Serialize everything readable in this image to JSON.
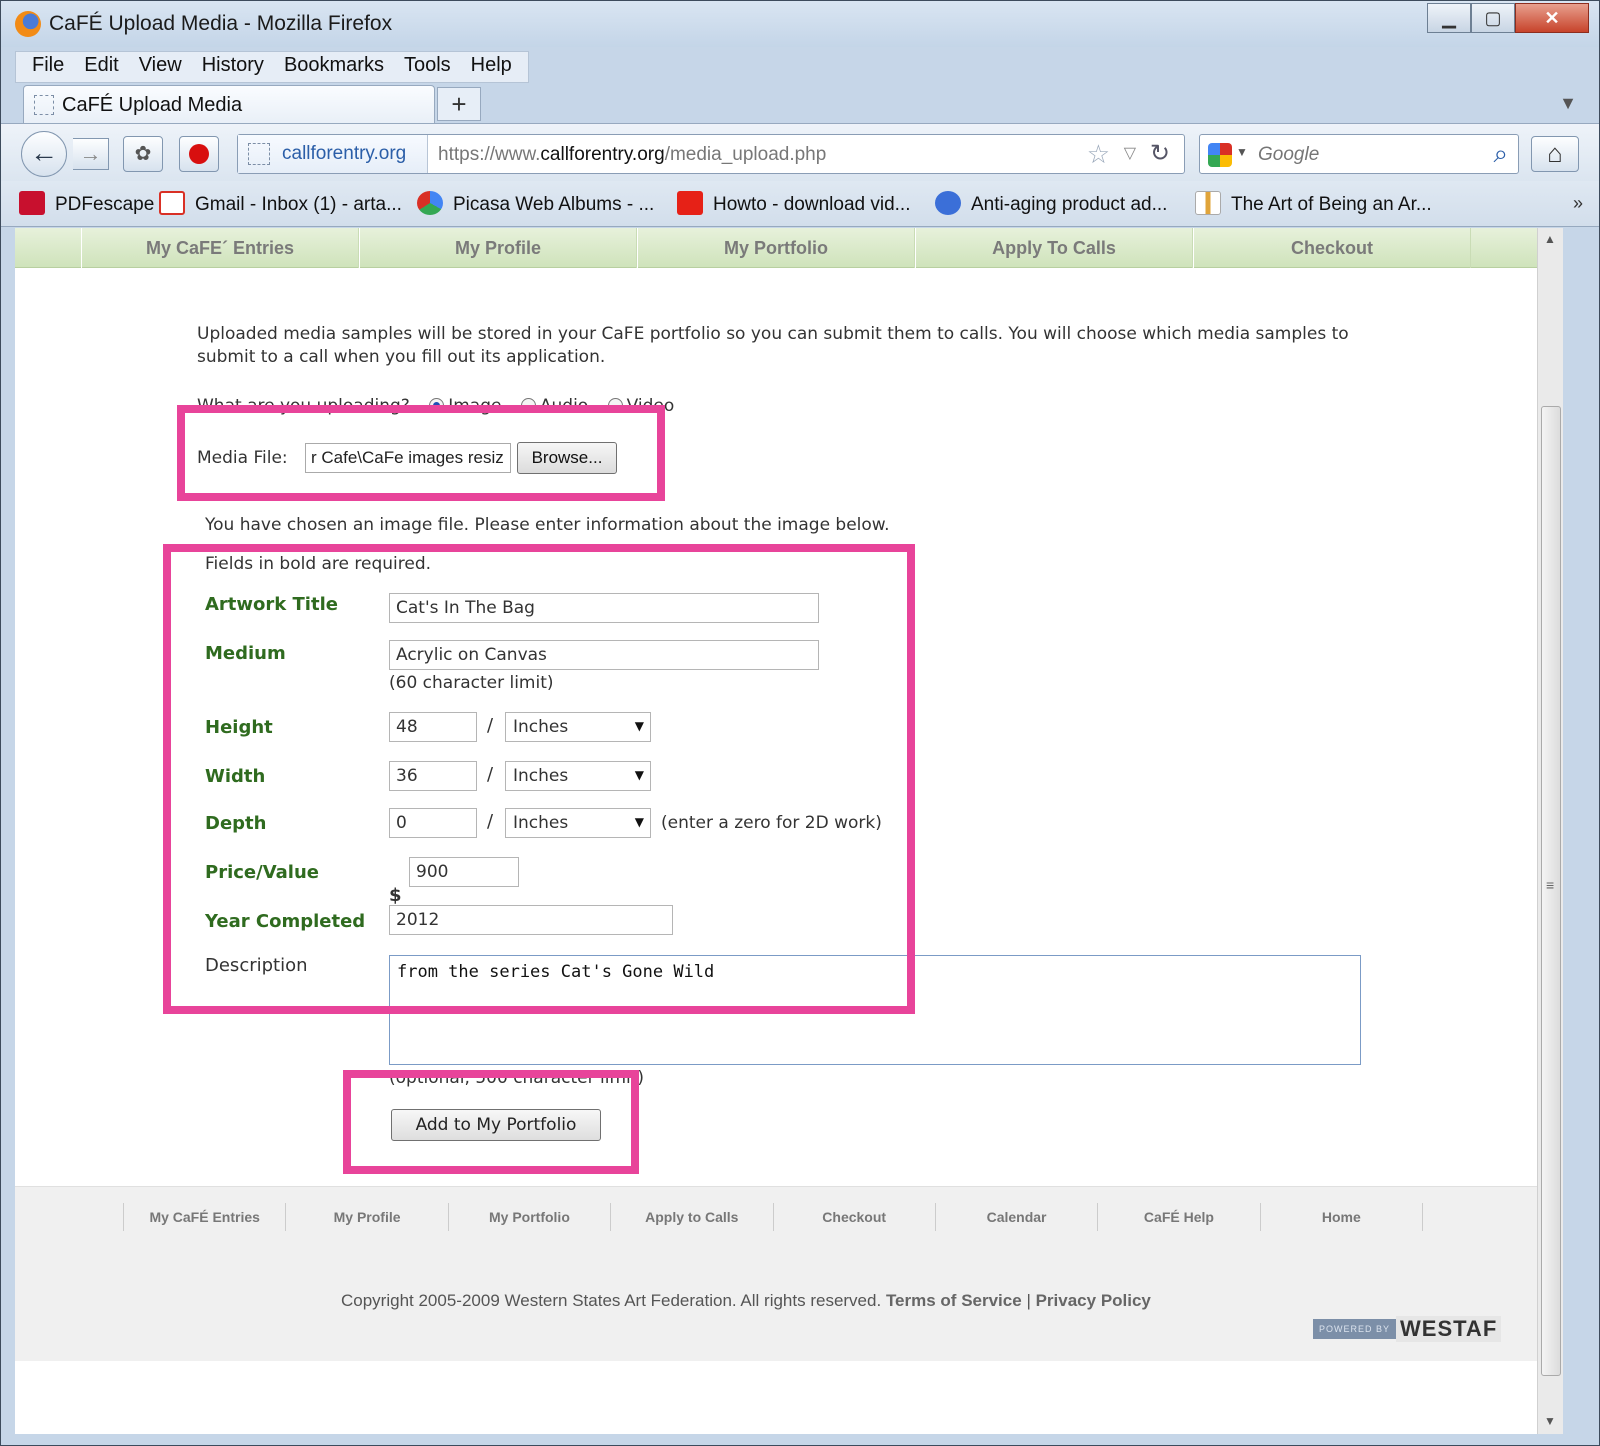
{
  "window": {
    "title": "CaFÉ Upload Media - Mozilla Firefox",
    "min": "▁",
    "max": "▢",
    "close": "✕"
  },
  "menu": [
    "File",
    "Edit",
    "View",
    "History",
    "Bookmarks",
    "Tools",
    "Help"
  ],
  "tab": {
    "label": "CaFÉ Upload Media",
    "new_tab": "+"
  },
  "nav": {
    "identity": "callforentry.org",
    "url_prefix": "https://www.",
    "url_domain": "callforentry.org",
    "url_path": "/media_upload.php",
    "search_placeholder": "Google"
  },
  "bookmarks": [
    {
      "label": "PDFescape",
      "icon": "pdf-icon",
      "color": "#c8102e"
    },
    {
      "label": "Gmail - Inbox (1) - arta...",
      "icon": "gmail-icon",
      "color": "#d93025"
    },
    {
      "label": "Picasa Web Albums - ...",
      "icon": "picasa-icon",
      "color": "#4285f4"
    },
    {
      "label": "Howto - download vid...",
      "icon": "youtube-icon",
      "color": "#e62117"
    },
    {
      "label": "Anti-aging product ad...",
      "icon": "globe-icon",
      "color": "#3b6fd8"
    },
    {
      "label": "The Art of Being an Ar...",
      "icon": "bookmark-page-icon",
      "color": "#e0a43a"
    }
  ],
  "bookmarks_more": "»",
  "site_nav": [
    "My CaFE´ Entries",
    "My Profile",
    "My Portfolio",
    "Apply To Calls",
    "Checkout"
  ],
  "page": {
    "intro": "Uploaded media samples will be stored in your CaFE portfolio so you can submit them to calls. You will choose which media samples to submit to a call when you fill out its application.",
    "upload_question": "What are you uploading?",
    "upload_types": [
      "Image",
      "Audio",
      "Video"
    ],
    "upload_selected": "Image",
    "media_file_label": "Media File:",
    "media_file_value": "r Cafe\\CaFe images resiz",
    "browse_label": "Browse...",
    "chosen_text": "You have chosen an image file. Please enter information about the image below.",
    "required_text": "Fields in bold are required."
  },
  "form": {
    "artwork_title_label": "Artwork Title",
    "artwork_title_value": "Cat's In The Bag",
    "medium_label": "Medium",
    "medium_value": "Acrylic on Canvas",
    "medium_note": "(60 character limit)",
    "height_label": "Height",
    "height_value": "48",
    "height_unit": "Inches",
    "width_label": "Width",
    "width_value": "36",
    "width_unit": "Inches",
    "depth_label": "Depth",
    "depth_value": "0",
    "depth_unit": "Inches",
    "depth_note": "(enter a zero for 2D work)",
    "slash": "/",
    "price_label": "Price/Value",
    "currency": "$",
    "price_value": "900",
    "year_label": "Year Completed",
    "year_value": "2012",
    "description_label": "Description",
    "description_value": "from the series Cat's Gone Wild",
    "description_note": "(optional, 500 character limit)",
    "submit_label": "Add to My Portfolio"
  },
  "footer": {
    "nav": [
      "My CaFÉ Entries",
      "My Profile",
      "My Portfolio",
      "Apply to Calls",
      "Checkout",
      "Calendar",
      "CaFÉ Help",
      "Home"
    ],
    "copyright": "Copyright 2005-2009 Western States Art Federation. All rights reserved.",
    "terms": "Terms of Service",
    "separator": "|",
    "privacy": "Privacy Policy",
    "powered_by": "POWERED BY",
    "westaf": "WESTAF"
  },
  "highlight_color": "#e8449a"
}
